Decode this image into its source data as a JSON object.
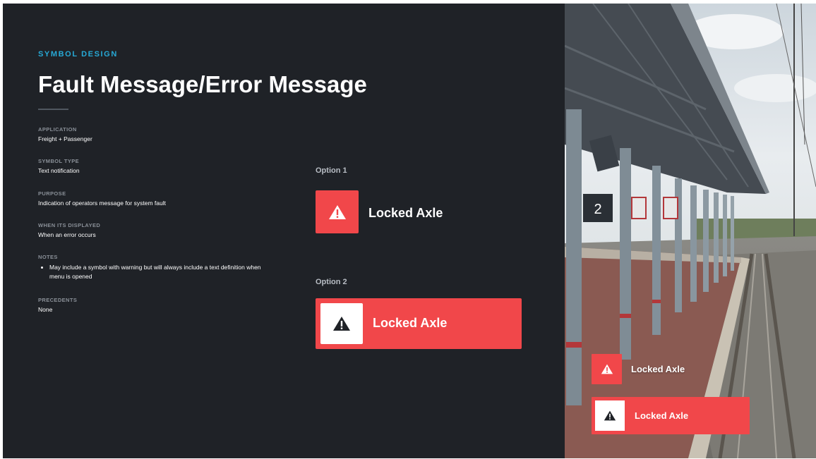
{
  "header": {
    "eyebrow": "SYMBOL DESIGN",
    "title": "Fault Message/Error Message"
  },
  "specs": {
    "application": {
      "label": "APPLICATION",
      "value": "Freight + Passenger"
    },
    "symbol_type": {
      "label": "SYMBOL TYPE",
      "value": "Text notification"
    },
    "purpose": {
      "label": "PURPOSE",
      "value": "Indication of operators message for system fault"
    },
    "when_displayed": {
      "label": "WHEN ITS DISPLAYED",
      "value": "When an error occurs"
    },
    "notes": {
      "label": "NOTES",
      "items": [
        "May include a symbol with warning but will always include a text definition when menu is opened"
      ]
    },
    "precedents": {
      "label": "PRECEDENTS",
      "value": "None"
    }
  },
  "options": [
    {
      "label": "Option 1",
      "message": "Locked Axle",
      "icon": "warning-triangle-icon"
    },
    {
      "label": "Option 2",
      "message": "Locked Axle",
      "icon": "warning-triangle-icon"
    }
  ],
  "photo": {
    "platform_sign": "2",
    "overlay_1": {
      "message": "Locked Axle",
      "icon": "warning-triangle-icon"
    },
    "overlay_2": {
      "message": "Locked Axle",
      "icon": "warning-triangle-icon"
    }
  },
  "colors": {
    "background": "#1f2227",
    "accent": "#27a9d6",
    "alert_red": "#f1474a",
    "text": "#ffffff"
  }
}
